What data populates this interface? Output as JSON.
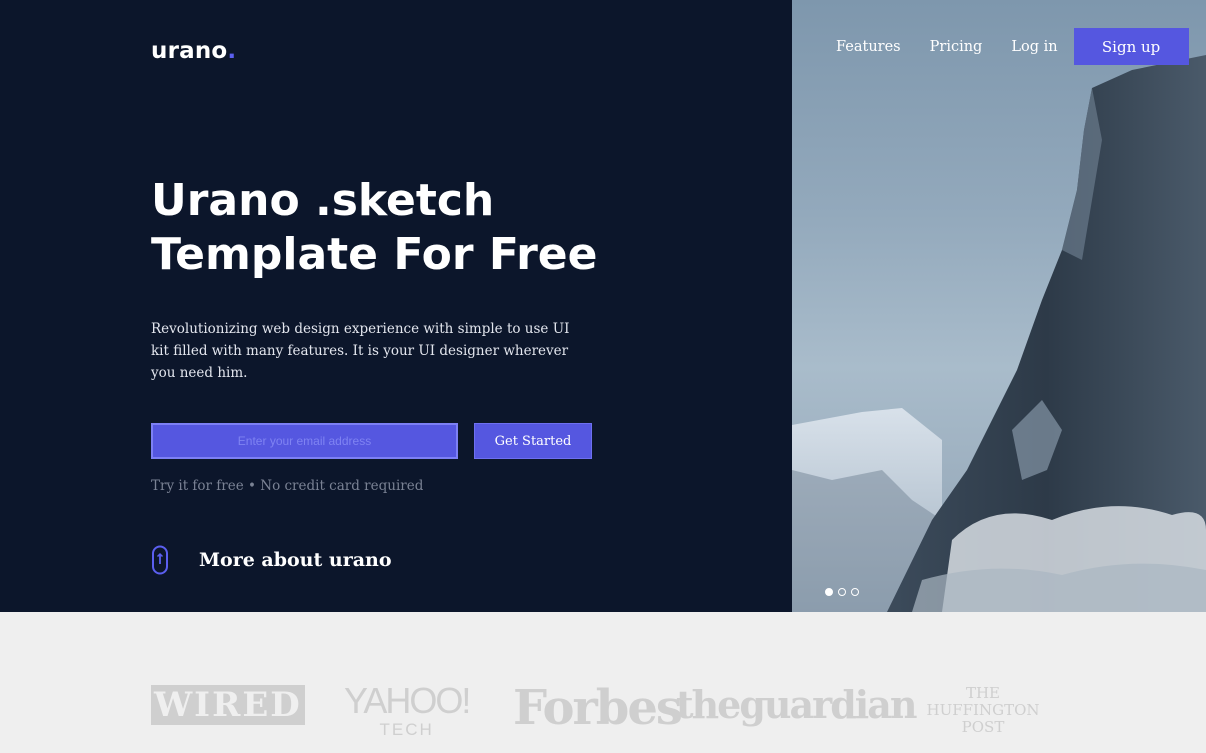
{
  "brand": {
    "name": "urano",
    "dot": ".",
    "accent": "#5557e0"
  },
  "nav": {
    "features": "Features",
    "pricing": "Pricing",
    "login": "Log in",
    "signup": "Sign up"
  },
  "hero": {
    "title_line1": "Urano .sketch",
    "title_line2": "Template For Free",
    "description": "Revolutionizing web design experience with simple to use UI kit filled with many features. It is your UI designer wherever you need him.",
    "email_placeholder": "Enter your email address",
    "cta": "Get Started",
    "hint": "Try it for free • No credit card required",
    "more": "More about urano",
    "more_icon": "mouse-scroll-icon"
  },
  "carousel": {
    "count": 3,
    "active": 0
  },
  "press": {
    "wired": "WIRED",
    "yahoo_main": "YAHOO!",
    "yahoo_sub": "TECH",
    "forbes": "Forbes",
    "guardian": "theguardian",
    "huffpo_1": "THE",
    "huffpo_2": "HUFFINGTON",
    "huffpo_3": "POST"
  },
  "colors": {
    "hero_bg": "#0c162b",
    "strip_bg": "#efefef",
    "logo_gray": "#cfcfcf"
  }
}
